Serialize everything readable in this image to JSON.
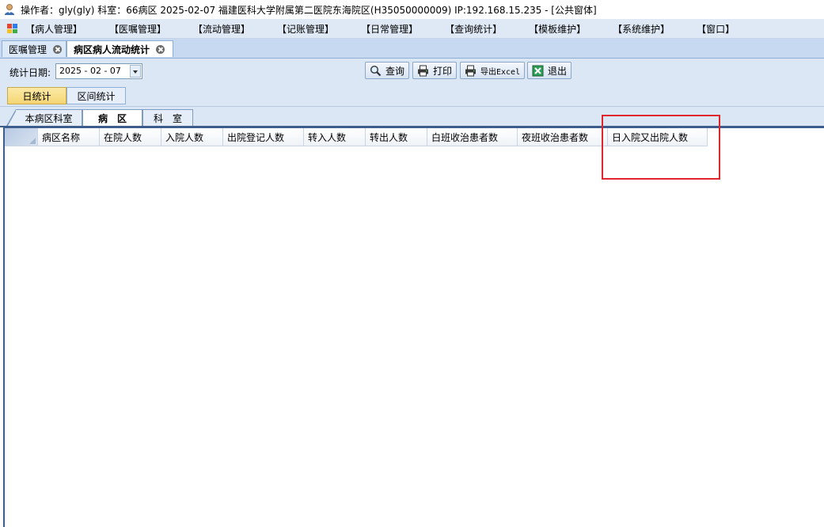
{
  "titlebar": {
    "text": "操作者：gly(gly)  科室：66病区  2025-02-07  福建医科大学附属第二医院东海院区(H35050000009) IP:192.168.15.235 - [公共窗体]",
    "icon": "user-icon"
  },
  "menu": {
    "system_icon": "app-menu-icon",
    "items": [
      "【病人管理】",
      "【医嘱管理】",
      "【流动管理】",
      "【记账管理】",
      "【日常管理】",
      "【查询统计】",
      "【模板维护】",
      "【系统维护】",
      "【窗口】"
    ]
  },
  "doc_tabs": [
    {
      "label": "医嘱管理",
      "active": false
    },
    {
      "label": "病区病人流动统计",
      "active": true
    }
  ],
  "toolbar": {
    "date_label": "统计日期:",
    "date_value": "2025 - 02 - 07",
    "buttons": [
      {
        "label": "查询",
        "icon": "search-icon"
      },
      {
        "label": "打印",
        "icon": "printer-icon"
      },
      {
        "label": "导出Excel",
        "icon": "export-icon"
      },
      {
        "label": "退出",
        "icon": "exit-icon"
      }
    ]
  },
  "stat_tabs": [
    {
      "label": "日统计",
      "active": true
    },
    {
      "label": "区间统计",
      "active": false
    }
  ],
  "view_tabs": [
    {
      "label": "本病区科室",
      "selected": false
    },
    {
      "label": "病　区",
      "selected": true
    },
    {
      "label": "科　室",
      "selected": false
    }
  ],
  "grid": {
    "columns": [
      "病区名称",
      "在院人数",
      "入院人数",
      "出院登记人数",
      "转入人数",
      "转出人数",
      "白班收治患者数",
      "夜班收治患者数",
      "日入院又出院人数"
    ],
    "rows": []
  },
  "colors": {
    "annotation_red": "#e0262b",
    "active_tab_yellow": "#f5d673",
    "menu_bg": "#dfe9f5"
  }
}
